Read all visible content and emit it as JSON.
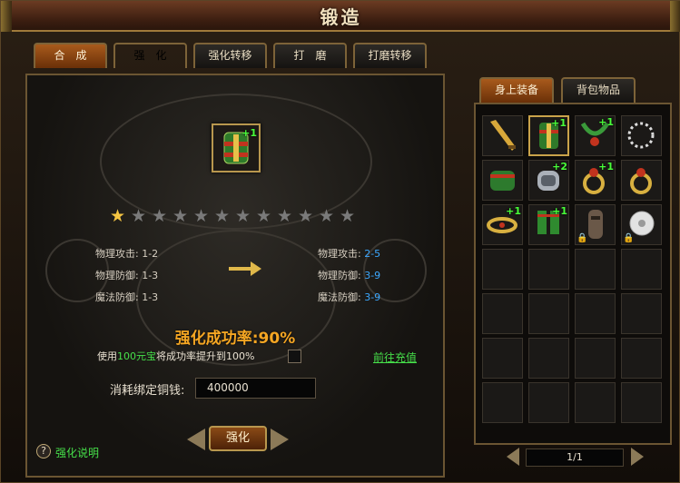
{
  "window": {
    "title": "锻造"
  },
  "tabs": [
    {
      "label": "合　成",
      "active": false
    },
    {
      "label": "强　化",
      "active": true
    },
    {
      "label": "强化转移",
      "active": false
    },
    {
      "label": "打　磨",
      "active": false
    },
    {
      "label": "打磨转移",
      "active": false
    }
  ],
  "forge": {
    "item_badge": "+1",
    "stars_lit": 1,
    "stars_total": 12,
    "stats_left": [
      {
        "label": "物理攻击:",
        "value": "1-2"
      },
      {
        "label": "物理防御:",
        "value": "1-3"
      },
      {
        "label": "魔法防御:",
        "value": "1-3"
      }
    ],
    "stats_right": [
      {
        "label": "物理攻击:",
        "value": "2-5"
      },
      {
        "label": "物理防御:",
        "value": "3-9"
      },
      {
        "label": "魔法防御:",
        "value": "3-9"
      }
    ],
    "success_rate": "强化成功率:90%",
    "yuanbao_prefix": "使用",
    "yuanbao_amount": "100元宝",
    "yuanbao_suffix": "将成功率提升到100%",
    "recharge_link": "前往充值",
    "cost_label": "消耗绑定铜钱:",
    "cost_value": "400000",
    "forge_button": "强化",
    "help_icon_text": "?",
    "help_label": "强化说明"
  },
  "inventory": {
    "tabs": [
      {
        "label": "身上装备",
        "active": true
      },
      {
        "label": "背包物品",
        "active": false
      }
    ],
    "items": [
      {
        "icon": "sword-icon",
        "badge": ""
      },
      {
        "icon": "bracer-icon",
        "badge": "+1",
        "selected": true
      },
      {
        "icon": "necklace-icon",
        "badge": "+1"
      },
      {
        "icon": "beads-icon",
        "badge": ""
      },
      {
        "icon": "belt-icon",
        "badge": ""
      },
      {
        "icon": "gauntlet-icon",
        "badge": "+2"
      },
      {
        "icon": "ring-icon",
        "badge": "+1"
      },
      {
        "icon": "ring-icon",
        "badge": ""
      },
      {
        "icon": "bangle-icon",
        "badge": "+1"
      },
      {
        "icon": "boots-icon",
        "badge": "+1"
      },
      {
        "icon": "talisman-icon",
        "badge": "",
        "locked": true
      },
      {
        "icon": "jade-disc-icon",
        "badge": "",
        "locked": true
      }
    ],
    "page": "1/1"
  },
  "colors": {
    "accent": "#f5a623",
    "green": "#46e04a",
    "blue": "#3ca8ff",
    "gold_border": "#b8974e"
  }
}
